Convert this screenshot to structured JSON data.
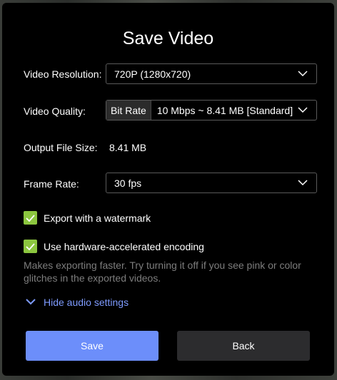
{
  "dialog": {
    "title": "Save Video"
  },
  "resolution": {
    "label": "Video Resolution:",
    "value": "720P (1280x720)"
  },
  "quality": {
    "label": "Video Quality:",
    "mode": "Bit Rate",
    "value": "10 Mbps ~ 8.41 MB [Standard]"
  },
  "output": {
    "label": "Output File Size:",
    "value": "8.41 MB"
  },
  "framerate": {
    "label": "Frame Rate:",
    "value": "30 fps"
  },
  "options": {
    "watermark": {
      "label": "Export with a watermark",
      "checked": true
    },
    "hardware": {
      "label": "Use hardware-accelerated encoding",
      "checked": true
    },
    "hint": "Makes exporting faster. Try turning it off if you see pink or color glitches in the exported videos."
  },
  "audio": {
    "toggle_label": "Hide audio settings",
    "icon": "chevron-down-icon"
  },
  "buttons": {
    "save": "Save",
    "back": "Back"
  },
  "colors": {
    "accent": "#6c8efa",
    "checkbox": "#8cc63f",
    "link": "#7e9bff",
    "dialog_bg": "#000000",
    "secondary_button": "#2c2c2e"
  }
}
